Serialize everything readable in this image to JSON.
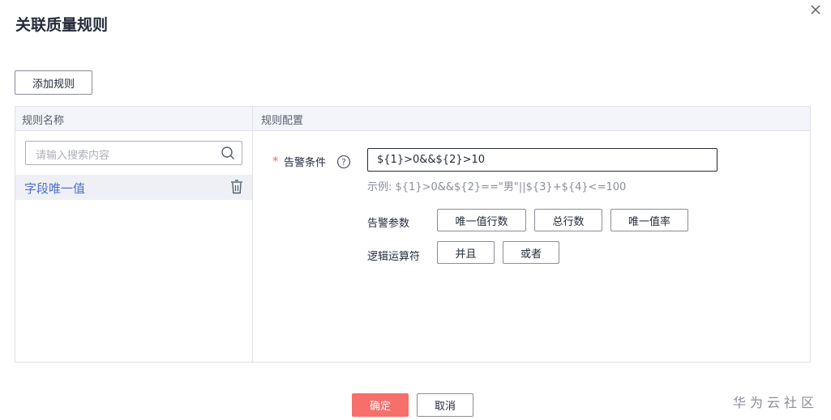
{
  "dialog": {
    "title": "关联质量规则",
    "close_icon": "close-icon"
  },
  "toolbar": {
    "add_rule_label": "添加规则"
  },
  "table": {
    "col_rule_name": "规则名称",
    "col_rule_config": "规则配置"
  },
  "search": {
    "placeholder": "请输入搜索内容"
  },
  "rules": [
    {
      "name": "字段唯一值"
    }
  ],
  "config": {
    "required_mark": "*",
    "alarm_condition_label": "告警条件",
    "alarm_condition_value": "${1}>0&&${2}>10",
    "example": "示例: ${1}>0&&${2}==\"男\"||${3}+${4}<=100",
    "alarm_params_label": "告警参数",
    "alarm_params": [
      "唯一值行数",
      "总行数",
      "唯一值率"
    ],
    "logic_ops_label": "逻辑运算符",
    "logic_ops": [
      "并且",
      "或者"
    ]
  },
  "footer": {
    "confirm_label": "确定",
    "cancel_label": "取消",
    "confirm_color": "#f66f6a"
  },
  "watermark": "华为云社区"
}
